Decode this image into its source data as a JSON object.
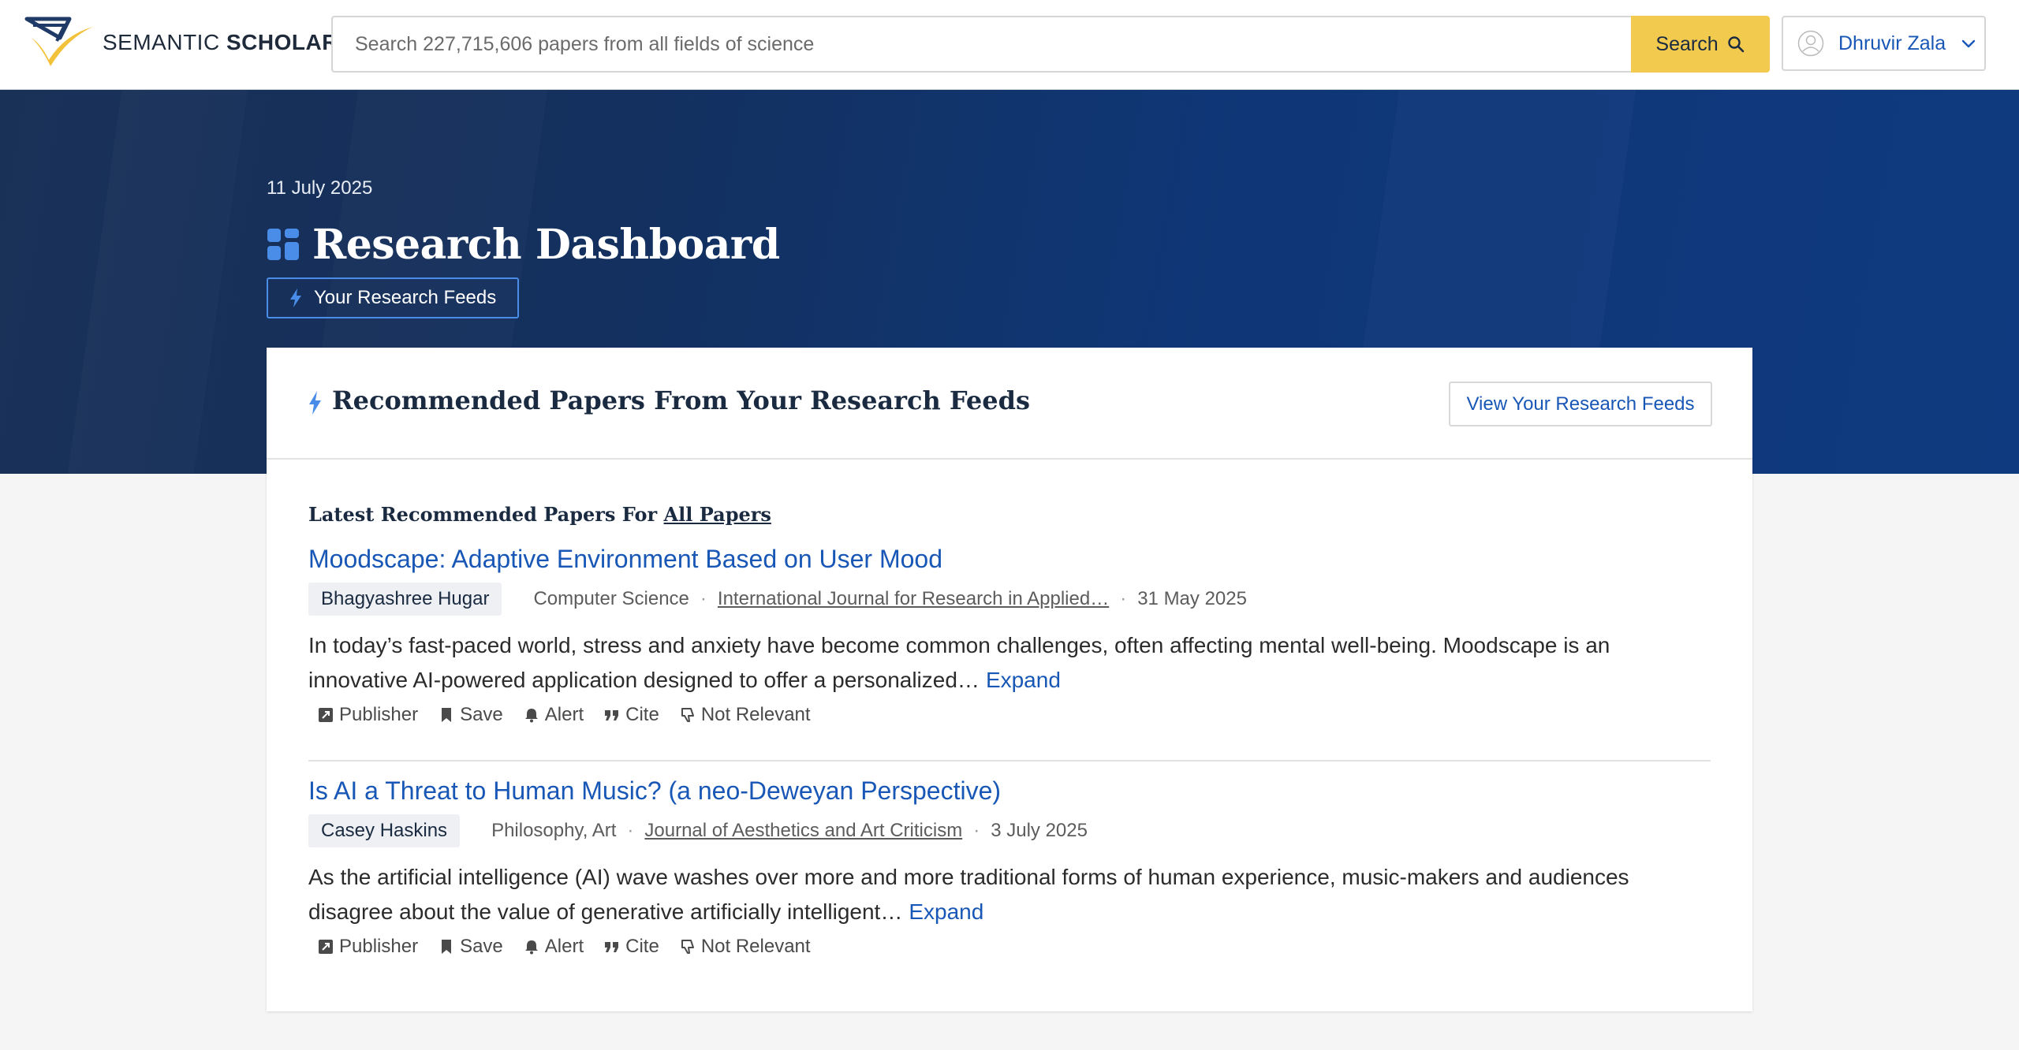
{
  "header": {
    "logo_text_light": "SEMANTIC",
    "logo_text_bold": "SCHOLAR",
    "search": {
      "placeholder": "Search 227,715,606 papers from all fields of science",
      "value": "",
      "button_label": "Search"
    },
    "user": {
      "name": "Dhruvir Zala"
    }
  },
  "hero": {
    "date": "11 July 2025",
    "title": "Research Dashboard",
    "tab_label": "Your Research Feeds"
  },
  "card": {
    "title": "Recommended Papers From Your Research Feeds",
    "view_button": "View Your Research Feeds",
    "latest_prefix": "Latest Recommended Papers For",
    "latest_link": "All Papers",
    "papers": [
      {
        "title": "Moodscape: Adaptive Environment Based on User Mood",
        "author": "Bhagyashree Hugar",
        "field": "Computer Science",
        "venue": "International Journal for Research in Applied…",
        "date": "31 May 2025",
        "abstract": "In today’s fast-paced world, stress and anxiety have become common challenges, often affecting mental well-being. Moodscape is an innovative AI-powered application designed to offer a personalized…",
        "expand": "Expand"
      },
      {
        "title": "Is AI a Threat to Human Music? (a neo-Deweyan Perspective)",
        "author": "Casey Haskins",
        "field": "Philosophy, Art",
        "venue": "Journal of Aesthetics and Art Criticism",
        "date": "3 July 2025",
        "abstract": "As the artificial intelligence (AI) wave washes over more and more traditional forms of human experience, music-makers and audiences disagree about the value of generative artificially intelligent…",
        "expand": "Expand"
      }
    ],
    "actions": {
      "publisher": "Publisher",
      "save": "Save",
      "alert": "Alert",
      "cite": "Cite",
      "not_relevant": "Not Relevant"
    }
  },
  "icons": {
    "logo": "semantic-scholar-logo",
    "search": "search-icon",
    "avatar": "user-circle-icon",
    "chevron": "chevron-down-icon",
    "dashboard": "grid-icon",
    "bolt": "bolt-icon",
    "publisher": "external-link-icon",
    "save": "bookmark-icon",
    "alert": "bell-icon",
    "cite": "quote-icon",
    "not_relevant": "thumbs-down-icon"
  },
  "colors": {
    "accent_blue": "#1857b6",
    "search_button": "#f2cb4e",
    "hero_bg": "#0f3777",
    "icon_blue": "#4a8de8"
  }
}
